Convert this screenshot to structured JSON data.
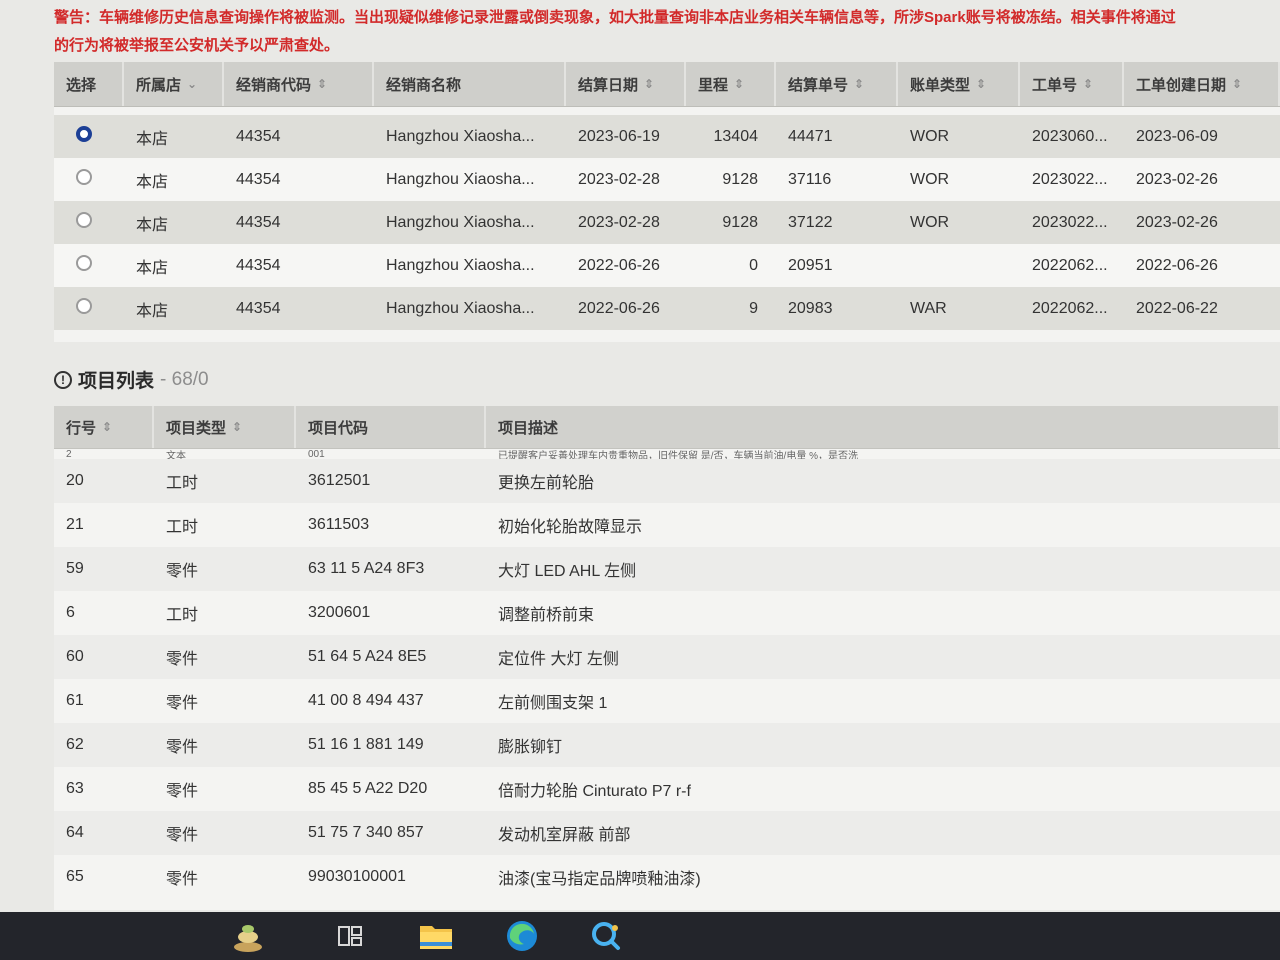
{
  "warning": {
    "line1": "警告：车辆维修历史信息查询操作将被监测。当出现疑似维修记录泄露或倒卖现象，如大批量查询非本店业务相关车辆信息等，所涉Spark账号将被冻结。相关事件将通过",
    "line2": "的行为将被举报至公安机关予以严肃查处。"
  },
  "orders": {
    "headers": [
      "选择",
      "所属店",
      "经销商代码",
      "经销商名称",
      "结算日期",
      "里程",
      "结算单号",
      "账单类型",
      "工单号",
      "工单创建日期"
    ],
    "rows": [
      {
        "selected": true,
        "store": "本店",
        "dealer_code": "44354",
        "dealer_name": "Hangzhou Xiaosha...",
        "settle_date": "2023-06-19",
        "mileage": "13404",
        "settle_no": "44471",
        "bill_type": "WOR",
        "order_no": "2023060...",
        "order_date": "2023-06-09"
      },
      {
        "selected": false,
        "store": "本店",
        "dealer_code": "44354",
        "dealer_name": "Hangzhou Xiaosha...",
        "settle_date": "2023-02-28",
        "mileage": "9128",
        "settle_no": "37116",
        "bill_type": "WOR",
        "order_no": "2023022...",
        "order_date": "2023-02-26"
      },
      {
        "selected": false,
        "store": "本店",
        "dealer_code": "44354",
        "dealer_name": "Hangzhou Xiaosha...",
        "settle_date": "2023-02-28",
        "mileage": "9128",
        "settle_no": "37122",
        "bill_type": "WOR",
        "order_no": "2023022...",
        "order_date": "2023-02-26"
      },
      {
        "selected": false,
        "store": "本店",
        "dealer_code": "44354",
        "dealer_name": "Hangzhou Xiaosha...",
        "settle_date": "2022-06-26",
        "mileage": "0",
        "settle_no": "20951",
        "bill_type": "",
        "order_no": "2022062...",
        "order_date": "2022-06-26"
      },
      {
        "selected": false,
        "store": "本店",
        "dealer_code": "44354",
        "dealer_name": "Hangzhou Xiaosha...",
        "settle_date": "2022-06-26",
        "mileage": "9",
        "settle_no": "20983",
        "bill_type": "WAR",
        "order_no": "2022062...",
        "order_date": "2022-06-22"
      }
    ]
  },
  "items": {
    "title": "项目列表",
    "count": "- 68/0",
    "headers": [
      "行号",
      "项目类型",
      "项目代码",
      "项目描述"
    ],
    "partial_top": {
      "line": "2",
      "type": "文本",
      "code": "001",
      "desc": "已提醒客户妥善处理车内贵重物品，旧件保留 是/否，车辆当前油/电量 %，是否洗"
    },
    "rows": [
      {
        "line": "20",
        "type": "工时",
        "code": "3612501",
        "desc": "更换左前轮胎"
      },
      {
        "line": "21",
        "type": "工时",
        "code": "3611503",
        "desc": "初始化轮胎故障显示"
      },
      {
        "line": "59",
        "type": "零件",
        "code": "63 11 5 A24 8F3",
        "desc": "大灯 LED AHL 左侧"
      },
      {
        "line": "6",
        "type": "工时",
        "code": "3200601",
        "desc": "调整前桥前束"
      },
      {
        "line": "60",
        "type": "零件",
        "code": "51 64 5 A24 8E5",
        "desc": "定位件 大灯 左侧"
      },
      {
        "line": "61",
        "type": "零件",
        "code": "41 00 8 494 437",
        "desc": "左前侧围支架 1"
      },
      {
        "line": "62",
        "type": "零件",
        "code": "51 16 1 881 149",
        "desc": "膨胀铆钉"
      },
      {
        "line": "63",
        "type": "零件",
        "code": "85 45 5 A22 D20",
        "desc": "倍耐力轮胎 Cinturato P7 r-f"
      },
      {
        "line": "64",
        "type": "零件",
        "code": "51 75 7 340 857",
        "desc": "发动机室屏蔽 前部"
      },
      {
        "line": "65",
        "type": "零件",
        "code": "99030100001",
        "desc": "油漆(宝马指定品牌喷釉油漆)"
      }
    ]
  },
  "taskbar": {
    "icons": [
      "plant-icon",
      "task-view-icon",
      "file-explorer-icon",
      "edge-browser-icon",
      "quick-assist-icon"
    ]
  }
}
